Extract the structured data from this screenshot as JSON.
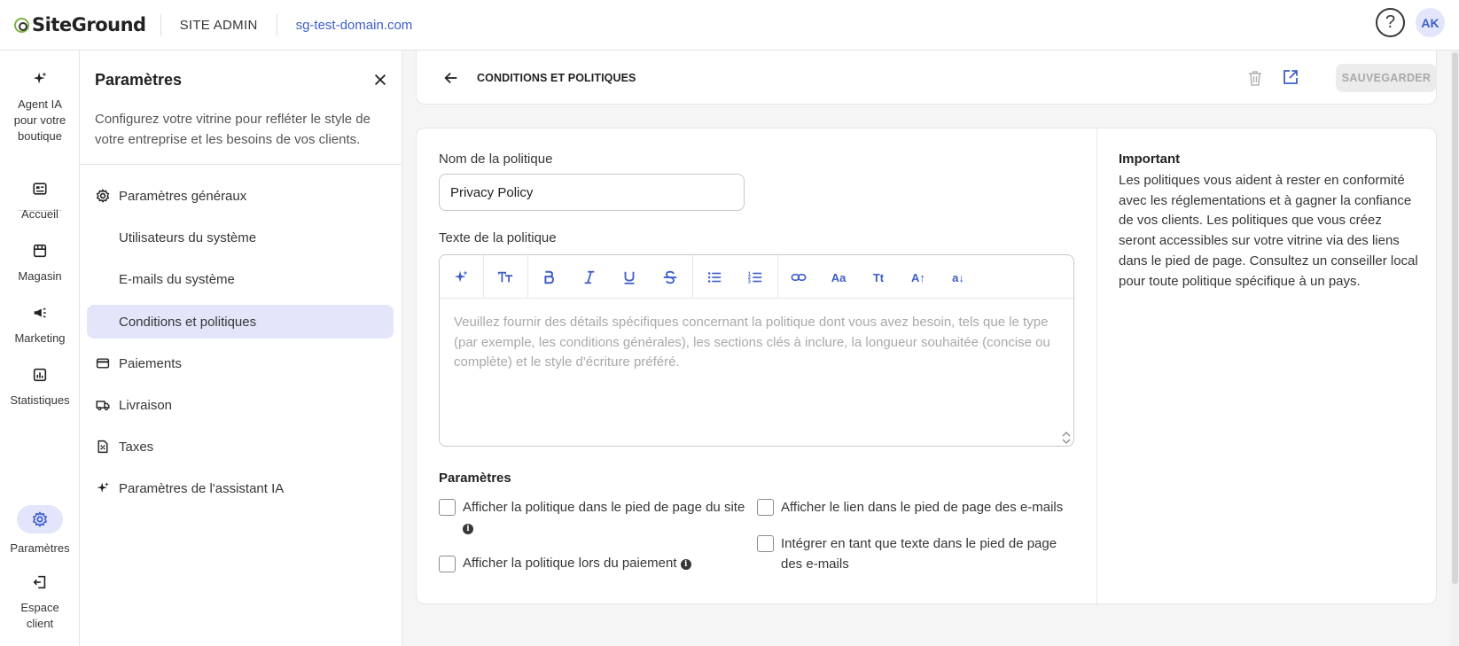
{
  "topbar": {
    "brand": "SiteGround",
    "site_admin": "SITE ADMIN",
    "domain": "sg-test-domain.com",
    "help_icon": "question-circle-icon",
    "avatar": "AK"
  },
  "rail": {
    "items": [
      {
        "label": "Agent IA pour votre boutique",
        "icon": "sparkles-icon"
      },
      {
        "label": "Accueil",
        "icon": "home-dashboard-icon"
      },
      {
        "label": "Magasin",
        "icon": "store-icon"
      },
      {
        "label": "Marketing",
        "icon": "megaphone-icon"
      },
      {
        "label": "Statistiques",
        "icon": "chart-icon"
      },
      {
        "label": "Paramètres",
        "icon": "gear-icon"
      },
      {
        "label": "Espace client",
        "icon": "logout-icon"
      }
    ],
    "active": "Paramètres"
  },
  "panel": {
    "title": "Paramètres",
    "description": "Configurez votre vitrine pour refléter le style de votre entreprise et les besoins de vos clients.",
    "items": [
      {
        "label": "Paramètres généraux",
        "icon": "gear-icon"
      },
      {
        "label": "Utilisateurs du système"
      },
      {
        "label": "E-mails du système"
      },
      {
        "label": "Conditions et politiques",
        "active": true
      },
      {
        "label": "Paiements",
        "icon": "card-icon"
      },
      {
        "label": "Livraison",
        "icon": "truck-icon"
      },
      {
        "label": "Taxes",
        "icon": "tax-document-icon"
      },
      {
        "label": "Paramètres de l'assistant IA",
        "icon": "sparkles-icon"
      }
    ]
  },
  "header": {
    "title": "CONDITIONS ET POLITIQUES",
    "save_label": "SAUVEGARDER"
  },
  "form": {
    "name_label": "Nom de la politique",
    "name_value": "Privacy Policy",
    "text_label": "Texte de la politique",
    "text_placeholder": "Veuillez fournir des détails spécifiques concernant la politique dont vous avez besoin, tels que le type (par exemple, les conditions générales), les sections clés à inclure, la longueur souhaitée (concise ou complète) et le style d'écriture préféré.",
    "toolbar": [
      "ai-sparkle-icon",
      "text-size-icon",
      "bold-icon",
      "italic-icon",
      "underline-icon",
      "strikethrough-icon",
      "bullet-list-icon",
      "numbered-list-icon",
      "link-icon",
      "Aa",
      "Tt",
      "A↑",
      "a↓"
    ],
    "params_title": "Paramètres",
    "checkboxes": [
      {
        "label": "Afficher la politique dans le pied de page du site",
        "checked": false
      },
      {
        "label": "Afficher la politique lors du paiement",
        "checked": false
      },
      {
        "label": "Afficher le lien dans le pied de page des e-mails",
        "checked": false
      },
      {
        "label": "Intégrer en tant que texte dans le pied de page des e-mails",
        "checked": false
      }
    ]
  },
  "important": {
    "title": "Important",
    "text": "Les politiques vous aident à rester en conformité avec les réglementations et à gagner la confiance de vos clients. Les politiques que vous créez seront accessibles sur votre vitrine via des liens dans le pied de page. Consultez un conseiller local pour toute politique spécifique à un pays."
  },
  "colors": {
    "accent": "#3e5ec9",
    "active_bg": "#e3e6fb",
    "brand_green": "#7cb342"
  }
}
